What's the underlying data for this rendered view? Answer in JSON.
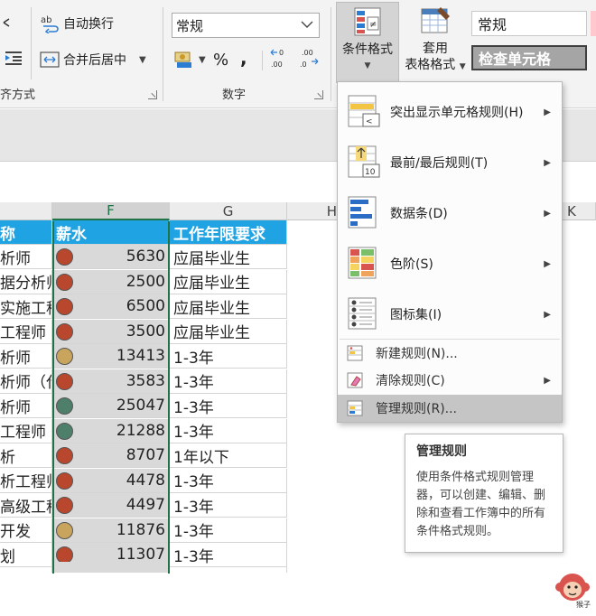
{
  "ribbon": {
    "wrap_text": "自动换行",
    "merge_center": "合并后居中",
    "alignment_group": "齐方式",
    "number_format_value": "常规",
    "percent_symbol": "%",
    "comma_symbol": ",",
    "number_group": "数字",
    "conditional_format_line1": "条件格式",
    "table_format_line1": "套用",
    "table_format_line2": "表格格式",
    "style_normal": "常规",
    "style_check_cell": "检查单元格"
  },
  "sheet": {
    "columns": [
      "F",
      "G",
      "H",
      "K"
    ],
    "header_row": {
      "col_e": "称",
      "col_f": "薪水",
      "col_g": "工作年限要求"
    },
    "rows": [
      {
        "e": "析师",
        "salary": "5630",
        "years": "应届毕业生",
        "dot": "#b8472e"
      },
      {
        "e": "据分析师",
        "salary": "2500",
        "years": "应届毕业生",
        "dot": "#b8472e"
      },
      {
        "e": "实施工程",
        "salary": "6500",
        "years": "应届毕业生",
        "dot": "#b8472e"
      },
      {
        "e": "工程师",
        "salary": "3500",
        "years": "应届毕业生",
        "dot": "#b8472e"
      },
      {
        "e": "析师",
        "salary": "13413",
        "years": "1-3年",
        "dot": "#c9a45c"
      },
      {
        "e": "析师（代",
        "salary": "3583",
        "years": "1-3年",
        "dot": "#b8472e"
      },
      {
        "e": "析师",
        "salary": "25047",
        "years": "1-3年",
        "dot": "#4e7f6a"
      },
      {
        "e": "工程师",
        "salary": "21288",
        "years": "1-3年",
        "dot": "#4e7f6a"
      },
      {
        "e": "析",
        "salary": "8707",
        "years": "1年以下",
        "dot": "#b8472e"
      },
      {
        "e": "析工程师",
        "salary": "4478",
        "years": "1-3年",
        "dot": "#b8472e"
      },
      {
        "e": "高级工程",
        "salary": "4497",
        "years": "1-3年",
        "dot": "#b8472e"
      },
      {
        "e": "开发",
        "salary": "11876",
        "years": "1-3年",
        "dot": "#c9a45c"
      },
      {
        "e": "划",
        "salary": "11307",
        "years": "1-3年",
        "dot": "#b8472e"
      }
    ]
  },
  "cf_menu": {
    "highlight_rules": "突出显示单元格规则(H)",
    "top_bottom_rules": "最前/最后规则(T)",
    "data_bars": "数据条(D)",
    "color_scales": "色阶(S)",
    "icon_sets": "图标集(I)",
    "new_rule": "新建规则(N)...",
    "clear_rules": "清除规则(C)",
    "manage_rules": "管理规则(R)..."
  },
  "tooltip": {
    "title": "管理规则",
    "body": "使用条件格式规则管理器，可以创建、编辑、删除和查看工作簿中的所有条件格式规则。"
  },
  "watermark": {
    "label": "猴子"
  },
  "colors": {
    "header_blue": "#1fa3e3",
    "selection_green": "#217346",
    "dot_red": "#b8472e",
    "dot_gold": "#c9a45c",
    "dot_green": "#4e7f6a"
  }
}
